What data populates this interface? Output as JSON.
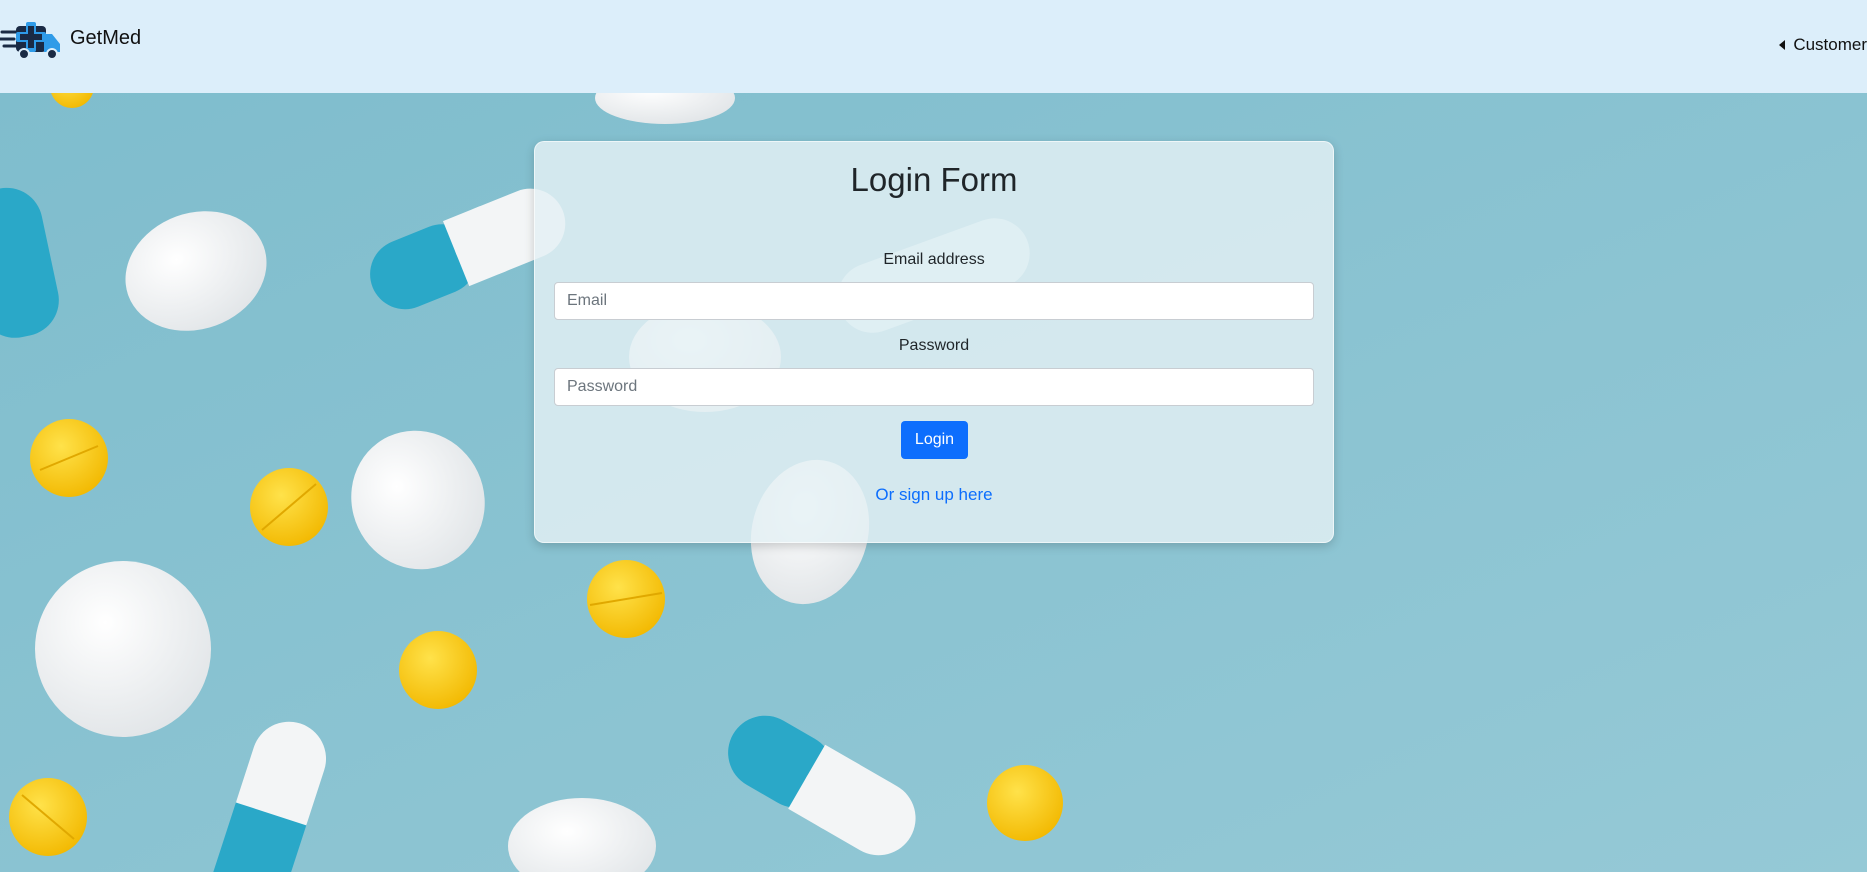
{
  "navbar": {
    "brand_name": "GetMed",
    "logo_icon": "delivery-truck-medical-cross-icon",
    "customer_label": "Customer",
    "dropdown_icon": "caret-left-icon"
  },
  "background": {
    "description_icon": "pills-background-image"
  },
  "login_form": {
    "title": "Login Form",
    "email_label": "Email address",
    "email_placeholder": "Email",
    "email_value": "",
    "password_label": "Password",
    "password_placeholder": "Password",
    "password_value": "",
    "login_button": "Login",
    "signup_link": "Or sign up here"
  },
  "colors": {
    "navbar_bg": "#dceefa",
    "primary": "#0d6efd",
    "background": "#8ec5d3"
  }
}
